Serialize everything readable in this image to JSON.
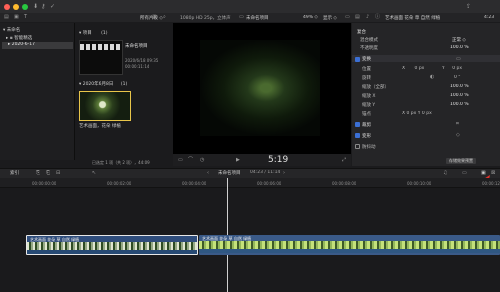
{
  "header": {
    "filter": "所有片段 ◇",
    "format": "1080p HD 25p，立体声",
    "project": "未命名项目",
    "zoom": "49% ◇",
    "view": "显示 ◇",
    "inspector_title": "艺术画面 花朵 草 自然 绿植",
    "inspector_duration": "4:23"
  },
  "sidebar": {
    "library": "未命名",
    "smart_collections": "智能精选",
    "event": "2020-6-17"
  },
  "browser": {
    "group1_title": "项目",
    "group1_count": "(1)",
    "project": {
      "name": "未命名项目",
      "date": "2020/6/18 09:35",
      "duration": "00:00:11:14"
    },
    "group2_title": "2020年6月8日",
    "group2_count": "(1)",
    "clip_name": "艺术画面，花朵 绿植",
    "status": "已选定 1 项（共 2 项），44:09"
  },
  "viewer": {
    "timecode": "5:19"
  },
  "inspector": {
    "compositing": "复合",
    "blend_label": "混合模式",
    "blend_value": "正常 ◇",
    "opacity_label": "不透明度",
    "opacity_value": "100.0 %",
    "transform": "变换",
    "position_label": "位置",
    "x_axis": "X",
    "position_x": "0 px",
    "y_axis": "Y",
    "position_y": "0 px",
    "rotation_label": "旋转",
    "rotation_value": "0 °",
    "scale_all_label": "缩放（全部）",
    "scale_all_value": "100.0 %",
    "scale_x_label": "缩放 X",
    "scale_x_value": "100.0 %",
    "scale_y_label": "缩放 Y",
    "scale_y_value": "100.0 %",
    "anchor_label": "锚点",
    "anchor_value": "X  0 px    Y  0 px",
    "crop": "裁剪",
    "distort": "变形",
    "stabilization": "防抖动",
    "save_preset": "存储效果预置"
  },
  "timeline": {
    "index": "索引",
    "project": "未命名项目",
    "duration": "04:23 / 11:14",
    "clip_label": "艺术画面 花朵 草 自然 绿植",
    "ruler": [
      "00:00:00:00",
      "00:00:02:00",
      "00:00:04:00",
      "00:00:06:00",
      "00:00:08:00",
      "00:00:10:00",
      "00:00:12:00"
    ]
  },
  "colors": {
    "accent": "#3b6fd4",
    "clip_blue": "#3a5a88",
    "annotation": "#e4312a",
    "selection": "#e8c54a"
  }
}
